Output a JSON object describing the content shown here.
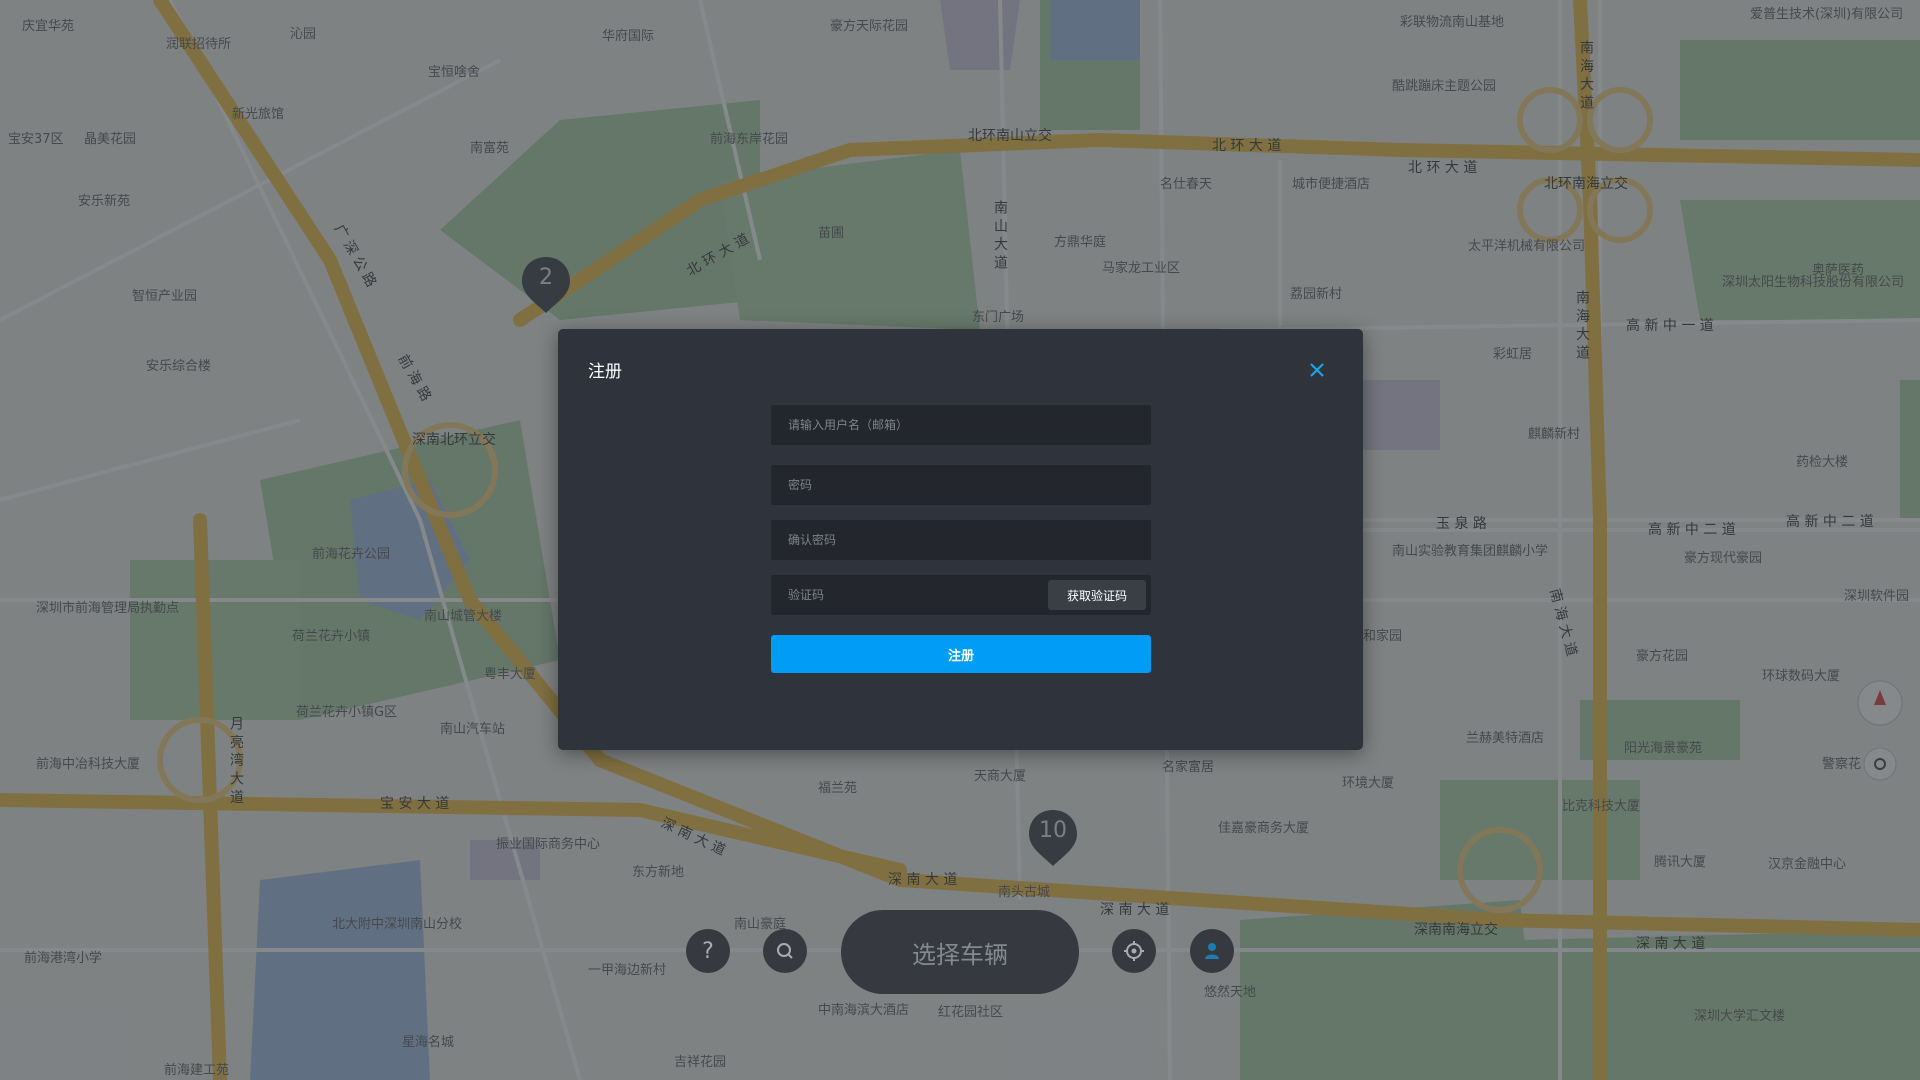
{
  "map": {
    "labels": [
      {
        "text": "庆宜华苑"
      },
      {
        "text": "润联招待所"
      },
      {
        "text": "沁园"
      },
      {
        "text": "华府国际"
      },
      {
        "text": "豪方天际花园"
      },
      {
        "text": "宝恒啥舍"
      },
      {
        "text": "新光旅馆"
      },
      {
        "text": "宝安37区"
      },
      {
        "text": "晶美花园"
      },
      {
        "text": "南富苑"
      },
      {
        "text": "前海东岸花园"
      },
      {
        "text": "安乐新苑"
      },
      {
        "text": "智恒产业园"
      },
      {
        "text": "安乐综合楼"
      },
      {
        "text": "苗圃"
      },
      {
        "text": "方鼎华庭"
      },
      {
        "text": "马家龙工业区"
      },
      {
        "text": "名仕春天"
      },
      {
        "text": "城市便捷酒店"
      },
      {
        "text": "荔园新村"
      },
      {
        "text": "东门广场"
      },
      {
        "text": "彩联物流南山基地"
      },
      {
        "text": "酷跳蹦床主题公园"
      },
      {
        "text": "太平洋机械有限公司"
      },
      {
        "text": "深圳太阳生物科技股份有限公司"
      },
      {
        "text": "奥萨医药"
      },
      {
        "text": "爱普生技术(深圳)有限公司"
      },
      {
        "text": "彩虹居"
      },
      {
        "text": "麒麟新村"
      },
      {
        "text": "药检大楼"
      },
      {
        "text": "南山实验教育集团麒麟小学"
      },
      {
        "text": "豪方现代豪园"
      },
      {
        "text": "深圳软件园"
      },
      {
        "text": "豪方花园"
      },
      {
        "text": "环球数码大厦"
      },
      {
        "text": "兰赫美特酒店"
      },
      {
        "text": "阳光海景豪苑"
      },
      {
        "text": "警察花"
      },
      {
        "text": "环境大厦"
      },
      {
        "text": "比克科技大厦"
      },
      {
        "text": "腾讯大厦"
      },
      {
        "text": "汉京金融中心"
      },
      {
        "text": "佳嘉豪商务大厦"
      },
      {
        "text": "名家富居"
      },
      {
        "text": "深圳市前海管理局执勤点"
      },
      {
        "text": "荷兰花卉小镇"
      },
      {
        "text": "南山城管大楼"
      },
      {
        "text": "粤丰大厦"
      },
      {
        "text": "荷兰花卉小镇G区"
      },
      {
        "text": "南山汽车站"
      },
      {
        "text": "前海中冶科技大厦"
      },
      {
        "text": "福兰苑"
      },
      {
        "text": "天商大厦"
      },
      {
        "text": "振业国际商务中心"
      },
      {
        "text": "东方新地"
      },
      {
        "text": "北大附中深圳南山分校"
      },
      {
        "text": "前海港湾小学"
      },
      {
        "text": "南山豪庭"
      },
      {
        "text": "一甲海边新村"
      },
      {
        "text": "中南海滨大酒店"
      },
      {
        "text": "红花园社区"
      },
      {
        "text": "悠然天地"
      },
      {
        "text": "星海名城"
      },
      {
        "text": "吉祥花园"
      },
      {
        "text": "前海建工苑"
      },
      {
        "text": "深圳大学汇文楼"
      },
      {
        "text": "南头古城"
      },
      {
        "text": "前海花卉公园"
      },
      {
        "text": "丰和家园"
      }
    ],
    "roads": [
      {
        "text": "北环南山立交"
      },
      {
        "text": "北 环 大 道"
      },
      {
        "text": "北 环 大 道"
      },
      {
        "text": "北环南海立交"
      },
      {
        "text": "北 环 大 道"
      },
      {
        "text": "深南北环立交"
      },
      {
        "text": "深 南 大 道"
      },
      {
        "text": "深 南 大 道"
      },
      {
        "text": "深 南 大 道"
      },
      {
        "text": "深南南海立交"
      },
      {
        "text": "深 南 大 道"
      },
      {
        "text": "宝 安 大 道"
      },
      {
        "text": "高 新 中 一 道"
      },
      {
        "text": "高 新 中 二 道"
      },
      {
        "text": "高 新 中 二 道"
      },
      {
        "text": "玉 泉 路"
      },
      {
        "text": "南 海 大 道"
      },
      {
        "text": "南 海 大 道"
      },
      {
        "text": "月 亮 湾 大 道"
      },
      {
        "text": "广 深 公 路"
      },
      {
        "text": "南 山 大 道"
      },
      {
        "text": "前 海 路"
      },
      {
        "text": "南 海 大 道"
      }
    ],
    "clusters": [
      {
        "count": "2"
      },
      {
        "count": "10"
      }
    ]
  },
  "modal": {
    "title": "注册",
    "username_placeholder": "请输入用户名（邮箱）",
    "password_placeholder": "密码",
    "confirm_placeholder": "确认密码",
    "code_placeholder": "验证码",
    "get_code_label": "获取验证码",
    "submit_label": "注册"
  },
  "bottom_bar": {
    "select_vehicle_label": "选择车辆"
  },
  "colors": {
    "accent": "#009cf5",
    "close_icon": "#1aa7ec",
    "modal_bg": "#2f333b",
    "field_bg": "#23262c"
  }
}
